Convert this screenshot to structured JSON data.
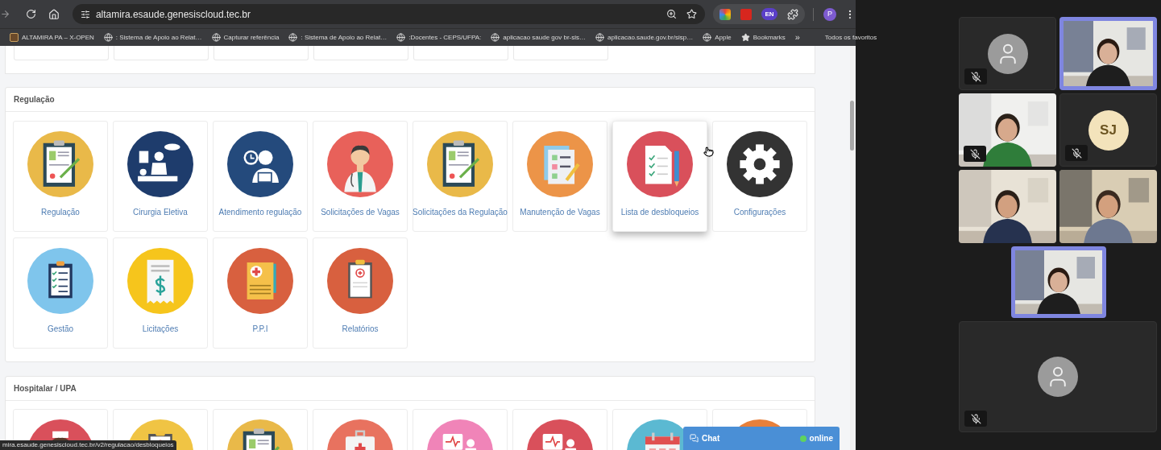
{
  "browser": {
    "url": "altamira.esaude.genesiscloud.tec.br",
    "extension_badge": "EN",
    "profile_initial": "P"
  },
  "bookmarks": [
    {
      "label": "ALTAMIRA PA – X-OPEN",
      "kind": "site"
    },
    {
      "label": ": Sistema de Apoio ao Relat…",
      "kind": "globe"
    },
    {
      "label": "Capturar referência",
      "kind": "globe"
    },
    {
      "label": ": Sistema de Apoio ao Relat…",
      "kind": "globe"
    },
    {
      "label": ":Docentes - CEPS/UFPA:",
      "kind": "globe"
    },
    {
      "label": "aplicacao saude gov br-sis…",
      "kind": "globe"
    },
    {
      "label": "aplicacao.saude.gov.br/sisp…",
      "kind": "globe"
    },
    {
      "label": "Apple",
      "kind": "globe"
    },
    {
      "label": "Bookmarks",
      "kind": "star"
    }
  ],
  "bookmarks_overflow": "»",
  "all_bookmarks": "Todos os favoritos",
  "previous_section_tiles": [
    {
      "kind": "tile"
    },
    {
      "kind": "tile"
    },
    {
      "kind": "tile"
    },
    {
      "kind": "tile"
    },
    {
      "kind": "tile"
    },
    {
      "kind": "tile"
    }
  ],
  "sections": [
    {
      "title": "Regulação",
      "tiles": [
        {
          "label": "Regulação",
          "kind": "clipboard-pen",
          "color": "#e9b949",
          "hovered": false
        },
        {
          "label": "Cirurgia Eletiva",
          "kind": "surgery",
          "color": "#1e3c6c",
          "hovered": false
        },
        {
          "label": "Atendimento regulação",
          "kind": "person-clock",
          "color": "#244a7c",
          "hovered": false
        },
        {
          "label": "Solicitações de Vagas",
          "kind": "doctor",
          "color": "#e8615a",
          "hovered": false
        },
        {
          "label": "Solicitações da Regulação",
          "kind": "clipboard-pen",
          "color": "#e9b949",
          "hovered": false
        },
        {
          "label": "Manutenção de Vagas",
          "kind": "checklist-pen",
          "color": "#ec9448",
          "hovered": false
        },
        {
          "label": "Lista de desbloqueios",
          "kind": "document-pencil",
          "color": "#d9505b",
          "hovered": true
        },
        {
          "label": "Configurações",
          "kind": "gear",
          "color": "#333333",
          "hovered": false
        },
        {
          "label": "Gestão",
          "kind": "checklist",
          "color": "#7fc5ec",
          "hovered": false
        },
        {
          "label": "Licitações",
          "kind": "receipt",
          "color": "#f6c51c",
          "hovered": false
        },
        {
          "label": "P.P.I",
          "kind": "medical-document",
          "color": "#d8603f",
          "hovered": false
        },
        {
          "label": "Relatórios",
          "kind": "clipboard-cross",
          "color": "#d8603f",
          "hovered": false
        }
      ]
    },
    {
      "title": "Hospitalar / UPA",
      "tiles": [
        {
          "kind": "nurse",
          "color": "#d9505b"
        },
        {
          "kind": "clipboard-cross",
          "color": "#f0c444"
        },
        {
          "kind": "clipboard-pen",
          "color": "#e9b949"
        },
        {
          "kind": "medkit",
          "color": "#e8725f"
        },
        {
          "kind": "patient-monitor",
          "color": "#f084b8"
        },
        {
          "kind": "patient-monitor",
          "color": "#d9505b"
        },
        {
          "kind": "calendar",
          "color": "#5bb9d2"
        },
        {
          "kind": "plain",
          "color": "#e8803a"
        }
      ]
    }
  ],
  "chat": {
    "label": "Chat",
    "status": "online",
    "online": true
  },
  "status_url": "mira.esaude.genesiscloud.tec.br/v2/regulacao/desbloqueios",
  "meeting": {
    "participants": [
      {
        "kind": "avatar",
        "muted": true,
        "speaking": false
      },
      {
        "kind": "video",
        "muted": false,
        "speaking": true
      },
      {
        "kind": "video",
        "muted": true,
        "speaking": false
      },
      {
        "kind": "initials",
        "initials": "SJ",
        "muted": true,
        "speaking": false
      },
      {
        "kind": "video",
        "muted": false,
        "speaking": false
      },
      {
        "kind": "video",
        "muted": false,
        "speaking": false
      },
      {
        "kind": "video",
        "muted": false,
        "speaking": true
      }
    ],
    "featured": {
      "kind": "avatar",
      "muted": true,
      "speaking": false
    }
  }
}
